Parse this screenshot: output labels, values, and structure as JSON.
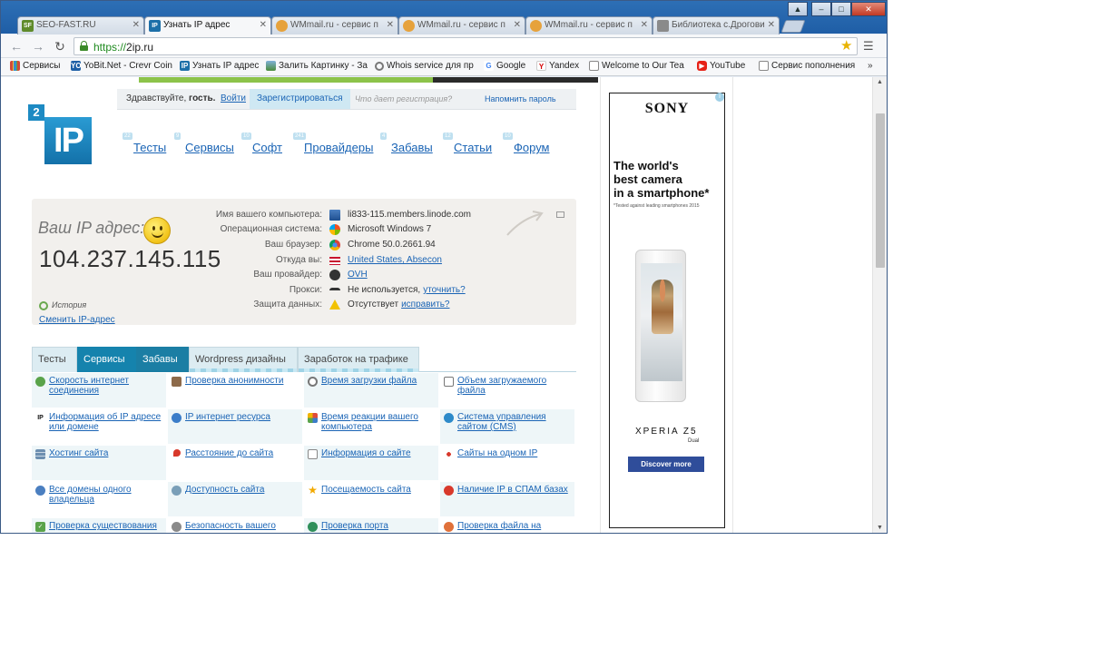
{
  "tabs": [
    {
      "label": "SEO-FAST.RU",
      "favicon": "SF"
    },
    {
      "label": "Узнать IP адрес",
      "favicon": "IP"
    },
    {
      "label": "WMmail.ru - сервис п",
      "favicon": ""
    },
    {
      "label": "WMmail.ru - сервис п",
      "favicon": ""
    },
    {
      "label": "WMmail.ru - сервис п",
      "favicon": ""
    },
    {
      "label": "Библиотека с.Дрогови",
      "favicon": ""
    }
  ],
  "toolbar": {
    "url_scheme": "https://",
    "url_host": "2ip.ru",
    "icons": {
      "back": "arrow-left-icon",
      "forward": "arrow-right-icon",
      "reload": "reload-icon",
      "bookmark": "star-icon",
      "menu": "hamburger-menu-icon"
    }
  },
  "bookmarks": [
    {
      "label": "Сервисы",
      "icon": "apps-grid-icon"
    },
    {
      "label": "YoBit.Net - Crevr Coin",
      "icon": "YO"
    },
    {
      "label": "Узнать IP адрес",
      "icon": "IP"
    },
    {
      "label": "Залить Картинку - За",
      "icon": "image-icon"
    },
    {
      "label": "Whois service для пр",
      "icon": "magnifier-icon"
    },
    {
      "label": "Google",
      "icon": "G"
    },
    {
      "label": "Yandex",
      "icon": "Y"
    },
    {
      "label": "Welcome to Our Tea",
      "icon": "page-icon"
    },
    {
      "label": "YouTube",
      "icon": "youtube-icon"
    },
    {
      "label": "Сервис пополнения",
      "icon": "page-icon"
    }
  ],
  "bookmarks_more": "»",
  "login": {
    "greeting_prefix": "Здравствуйте,",
    "greeting_name": "гость.",
    "login_link": "Войти",
    "register": "Зарегистрироваться",
    "why": "Что дает регистрация?",
    "remind": "Напомнить пароль"
  },
  "logo": {
    "superscript": "2",
    "main": "IP"
  },
  "nav": [
    {
      "label": "Тесты",
      "badge": "22"
    },
    {
      "label": "Сервисы",
      "badge": "9"
    },
    {
      "label": "Софт",
      "badge": "10"
    },
    {
      "label": "Провайдеры",
      "badge": "241"
    },
    {
      "label": "Забавы",
      "badge": "4"
    },
    {
      "label": "Статьи",
      "badge": "12"
    },
    {
      "label": "Форум",
      "badge": "10"
    }
  ],
  "ip_info": {
    "label": "Ваш IP адрес:",
    "address": "104.237.145.115",
    "rows": [
      {
        "key": "Имя вашего компьютера:",
        "value": "li833-115.members.linode.com",
        "link": false,
        "icon": "computer-icon"
      },
      {
        "key": "Операционная система:",
        "value": "Microsoft Windows 7",
        "link": false,
        "icon": "windows-icon"
      },
      {
        "key": "Ваш браузер:",
        "value": "Chrome 50.0.2661.94",
        "link": false,
        "icon": "chrome-icon"
      },
      {
        "key": "Откуда вы:",
        "value": "United States, Absecon",
        "link": true,
        "icon": "us-flag-icon"
      },
      {
        "key": "Ваш провайдер:",
        "value": "OVH",
        "link": true,
        "icon": "provider-icon"
      },
      {
        "key": "Прокси:",
        "value": "Не используется,",
        "extra": "уточнить?",
        "link": false,
        "icon": "glasses-icon"
      },
      {
        "key": "Защита данных:",
        "value": "Отсутствует",
        "extra": "исправить?",
        "link": false,
        "icon": "warning-icon"
      }
    ],
    "history": "История",
    "change": "Сменить IP-адрес"
  },
  "page_tabs": [
    "Тесты",
    "Сервисы",
    "Забавы",
    "Wordpress дизайны",
    "Заработок на трафике"
  ],
  "services": [
    [
      "Скорость интернет соединения",
      "Проверка анонимности",
      "Время загрузки файла",
      "Объем загружаемого файла"
    ],
    [
      "Информация об IP адресе или домене",
      "IP интернет ресурса",
      "Время реакции вашего компьютера",
      "Система управления сайтом (CMS)"
    ],
    [
      "Хостинг сайта",
      "Расстояние до сайта",
      "Информация о сайте",
      "Сайты на одном IP"
    ],
    [
      "Все домены одного владельца",
      "Доступность сайта",
      "Посещаемость сайта",
      "Наличие IP в СПАМ базах"
    ],
    [
      "Проверка существования",
      "Безопасность вашего",
      "Проверка порта",
      "Проверка файла на"
    ]
  ],
  "ad": {
    "brand": "SONY",
    "headline": [
      "The world's",
      "best camera",
      "in a smartphone*"
    ],
    "fine_print": "*Tested against leading smartphones 2015",
    "model": "XPERIA Z5",
    "model_sub": "Dual",
    "cta": "Discover more",
    "info": "i"
  }
}
